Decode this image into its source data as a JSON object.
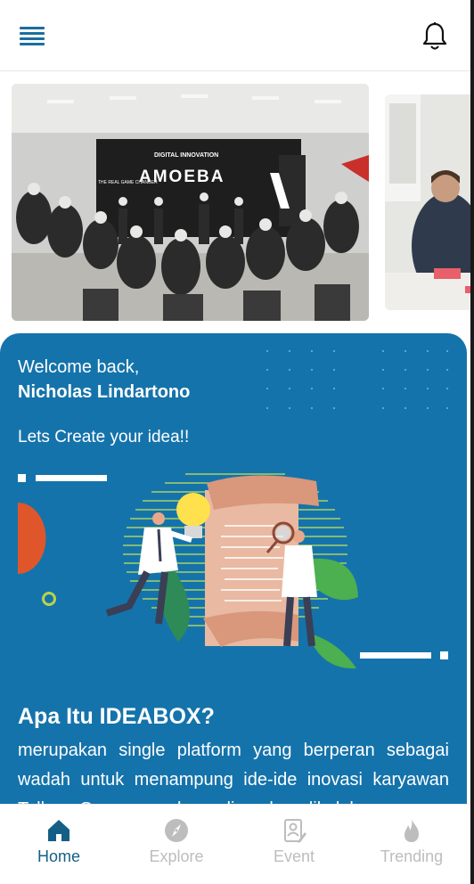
{
  "header": {
    "menu_icon": "hamburger-menu-icon",
    "notification_icon": "bell-icon"
  },
  "carousel": {
    "slides": [
      {
        "sign_text": "DIGITAL INNOVATION",
        "screen_title": "AMOEBA",
        "side_text": "THE REAL GAME CHANGER"
      },
      {
        "image": "office-meeting-photo"
      }
    ]
  },
  "welcome": {
    "greeting": "Welcome back,",
    "user_name": "Nicholas Lindartono",
    "call_to_action": "Lets Create your idea!!"
  },
  "about": {
    "title": "Apa Itu IDEABOX?",
    "description": "merupakan single platform yang berperan sebagai wadah untuk menampung ide-ide inovasi karyawan Telkom Group yang kemudian akan dikelola"
  },
  "bottom_nav": {
    "items": [
      {
        "label": "Home",
        "icon": "home-icon",
        "active": true
      },
      {
        "label": "Explore",
        "icon": "compass-icon",
        "active": false
      },
      {
        "label": "Event",
        "icon": "event-badge-icon",
        "active": false
      },
      {
        "label": "Trending",
        "icon": "flame-icon",
        "active": false
      }
    ]
  },
  "colors": {
    "primary": "#1573ab",
    "nav_active": "#155f86",
    "nav_inactive": "#bdbdbd",
    "accent_orange": "#e0562b"
  }
}
